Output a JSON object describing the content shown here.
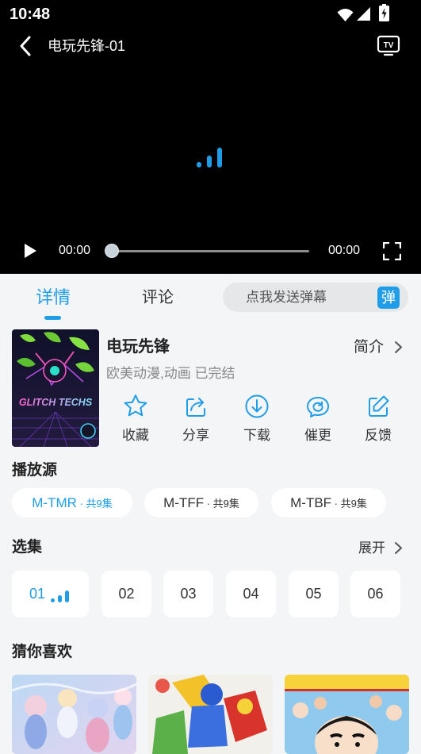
{
  "theme": {
    "accent": "#1f9de6",
    "page_bg": "#f4f5f7"
  },
  "status_bar": {
    "time": "10:48",
    "icons": [
      "wifi-icon",
      "cell-signal-icon",
      "battery-charging-icon"
    ]
  },
  "player": {
    "title": "电玩先锋-01",
    "cast_icon_text": "TV",
    "current_time": "00:00",
    "duration": "00:00",
    "progress": 0,
    "loading": true
  },
  "tabs": [
    {
      "label": "详情",
      "active": true
    },
    {
      "label": "评论",
      "active": false
    }
  ],
  "danmaku": {
    "placeholder": "点我发送弹幕",
    "badge": "弹"
  },
  "show": {
    "title": "电玩先锋",
    "meta": "欧美动漫,动画 已完结",
    "intro_label": "简介",
    "poster_text": "GLITCH TECHS"
  },
  "actions": [
    {
      "label": "收藏",
      "icon": "star-icon"
    },
    {
      "label": "分享",
      "icon": "share-icon"
    },
    {
      "label": "下载",
      "icon": "download-icon"
    },
    {
      "label": "催更",
      "icon": "urge-update-icon"
    },
    {
      "label": "反馈",
      "icon": "feedback-edit-icon"
    }
  ],
  "sources": {
    "heading": "播放源",
    "items": [
      {
        "name": "M-TMR",
        "count": " · 共9集",
        "active": true
      },
      {
        "name": "M-TFF",
        "count": " · 共9集",
        "active": false
      },
      {
        "name": "M-TBF",
        "count": " · 共9集",
        "active": false
      }
    ]
  },
  "episodes": {
    "heading": "选集",
    "expand_label": "展开",
    "items": [
      {
        "label": "01",
        "active": true,
        "playing": true
      },
      {
        "label": "02",
        "active": false
      },
      {
        "label": "03",
        "active": false
      },
      {
        "label": "04",
        "active": false
      },
      {
        "label": "05",
        "active": false
      },
      {
        "label": "06",
        "active": false
      }
    ]
  },
  "recommend": {
    "heading": "猜你喜欢"
  }
}
